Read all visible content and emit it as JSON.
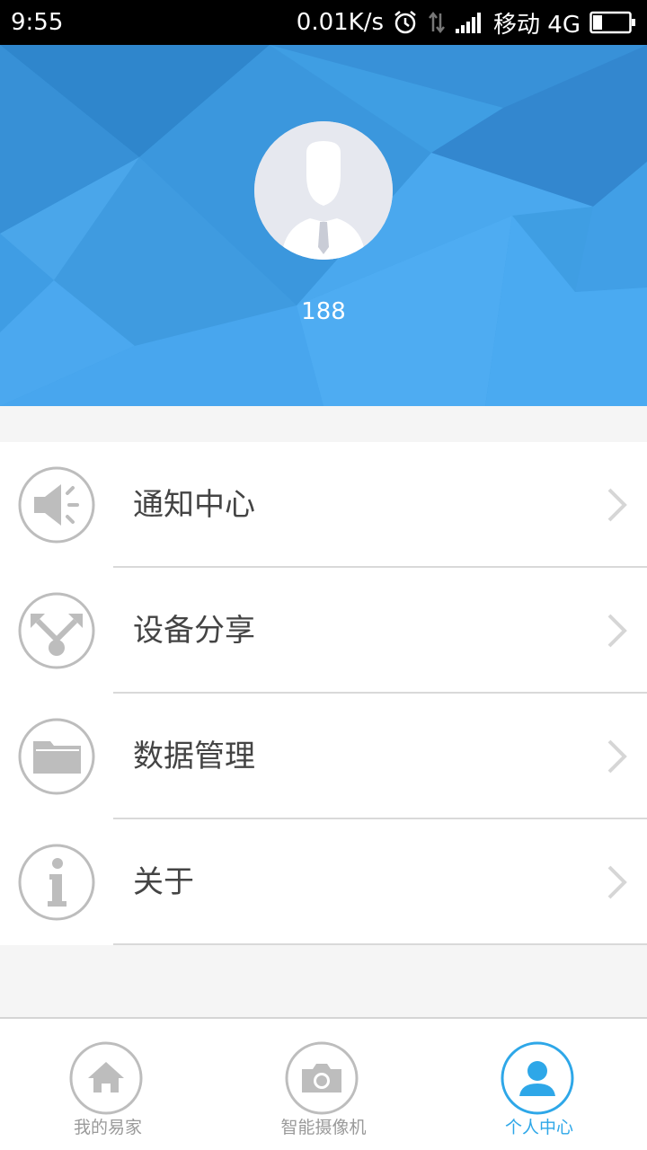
{
  "status_bar": {
    "time": "9:55",
    "speed": "0.01K/s",
    "carrier": "移动 4G"
  },
  "profile": {
    "username": "188"
  },
  "menu": {
    "items": [
      {
        "label": "通知中心",
        "icon": "speaker-icon"
      },
      {
        "label": "设备分享",
        "icon": "share-icon"
      },
      {
        "label": "数据管理",
        "icon": "folder-icon"
      },
      {
        "label": "关于",
        "icon": "info-icon"
      }
    ]
  },
  "tabs": [
    {
      "label": "我的易家",
      "icon": "home-icon",
      "active": false
    },
    {
      "label": "智能摄像机",
      "icon": "camera-icon",
      "active": false
    },
    {
      "label": "个人中心",
      "icon": "user-icon",
      "active": true
    }
  ],
  "colors": {
    "header": "#3d9be0",
    "accent": "#2ea7e8",
    "icon_gray": "#bdbdbd"
  }
}
